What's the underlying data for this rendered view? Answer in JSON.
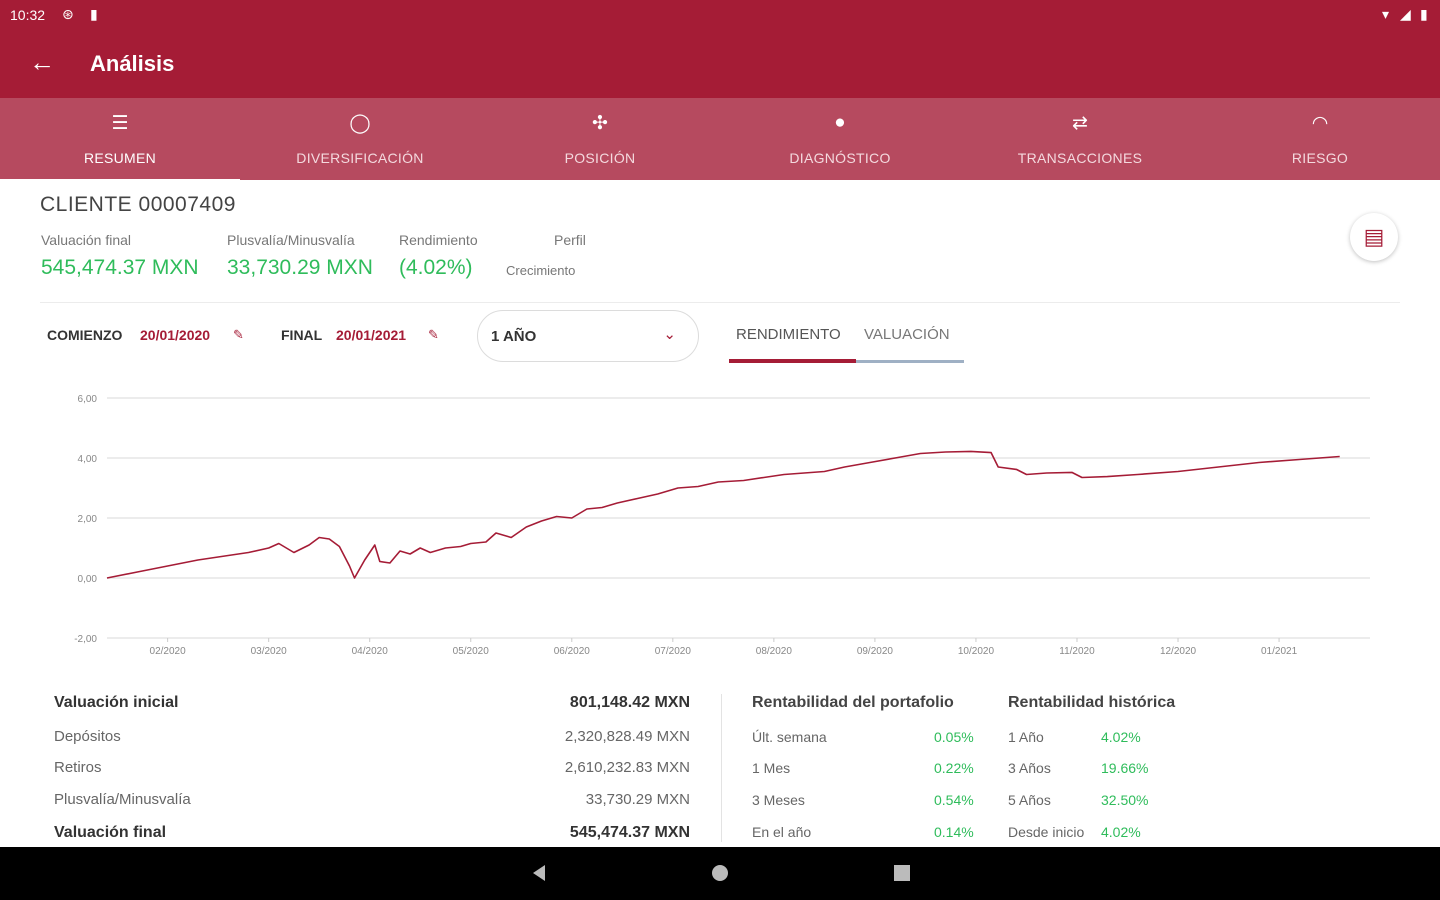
{
  "status_bar": {
    "time": "10:32"
  },
  "app_bar": {
    "title": "Análisis"
  },
  "tabs": [
    {
      "label": "RESUMEN",
      "icon": "list-icon",
      "active": true
    },
    {
      "label": "DIVERSIFICACIÓN",
      "icon": "donut-icon"
    },
    {
      "label": "POSICIÓN",
      "icon": "grid-icon"
    },
    {
      "label": "DIAGNÓSTICO",
      "icon": "magnifier-icon"
    },
    {
      "label": "TRANSACCIONES",
      "icon": "swap-icon"
    },
    {
      "label": "RIESGO",
      "icon": "gauge-icon"
    }
  ],
  "client": {
    "name": "CLIENTE 00007409",
    "valuacion_label": "Valuación final",
    "valuacion_value": "545,474.37 MXN",
    "plusvalia_label": "Plusvalía/Minusvalía",
    "plusvalia_value": "33,730.29 MXN",
    "rendimiento_label": "Rendimiento",
    "rendimiento_value": "(4.02%)",
    "perfil_label": "Perfil",
    "perfil_value": "Crecimiento"
  },
  "filters": {
    "start_label": "COMIENZO",
    "start_date": "20/01/2020",
    "end_label": "FINAL",
    "end_date": "20/01/2021",
    "period_value": "1 AÑO",
    "segment_rendimiento": "RENDIMIENTO",
    "segment_valuacion": "VALUACIÓN"
  },
  "chart_data": {
    "type": "line",
    "ylim": [
      -2,
      6
    ],
    "y_ticks": [
      "6,00",
      "4,00",
      "2,00",
      "0,00",
      "-2,00"
    ],
    "x_ticks": [
      "02/2020",
      "03/2020",
      "04/2020",
      "05/2020",
      "06/2020",
      "07/2020",
      "08/2020",
      "09/2020",
      "10/2020",
      "11/2020",
      "12/2020",
      "01/2021"
    ],
    "series": [
      {
        "color": "#a51c36",
        "points": [
          [
            0.0,
            0.0
          ],
          [
            0.3,
            0.2
          ],
          [
            0.6,
            0.4
          ],
          [
            0.9,
            0.6
          ],
          [
            1.2,
            0.75
          ],
          [
            1.4,
            0.85
          ],
          [
            1.6,
            1.0
          ],
          [
            1.7,
            1.15
          ],
          [
            1.85,
            0.85
          ],
          [
            2.0,
            1.1
          ],
          [
            2.1,
            1.35
          ],
          [
            2.2,
            1.3
          ],
          [
            2.3,
            1.05
          ],
          [
            2.4,
            0.4
          ],
          [
            2.45,
            0.0
          ],
          [
            2.55,
            0.6
          ],
          [
            2.65,
            1.1
          ],
          [
            2.7,
            0.55
          ],
          [
            2.8,
            0.5
          ],
          [
            2.9,
            0.9
          ],
          [
            3.0,
            0.8
          ],
          [
            3.1,
            1.0
          ],
          [
            3.2,
            0.85
          ],
          [
            3.35,
            1.0
          ],
          [
            3.5,
            1.05
          ],
          [
            3.6,
            1.15
          ],
          [
            3.75,
            1.2
          ],
          [
            3.85,
            1.5
          ],
          [
            4.0,
            1.35
          ],
          [
            4.15,
            1.7
          ],
          [
            4.3,
            1.9
          ],
          [
            4.45,
            2.05
          ],
          [
            4.6,
            2.0
          ],
          [
            4.75,
            2.3
          ],
          [
            4.9,
            2.35
          ],
          [
            5.05,
            2.5
          ],
          [
            5.25,
            2.65
          ],
          [
            5.45,
            2.8
          ],
          [
            5.65,
            3.0
          ],
          [
            5.85,
            3.05
          ],
          [
            6.05,
            3.2
          ],
          [
            6.3,
            3.25
          ],
          [
            6.5,
            3.35
          ],
          [
            6.7,
            3.45
          ],
          [
            6.9,
            3.5
          ],
          [
            7.1,
            3.55
          ],
          [
            7.3,
            3.7
          ],
          [
            7.55,
            3.85
          ],
          [
            7.8,
            4.0
          ],
          [
            8.05,
            4.15
          ],
          [
            8.3,
            4.2
          ],
          [
            8.55,
            4.22
          ],
          [
            8.75,
            4.18
          ],
          [
            8.82,
            3.7
          ],
          [
            9.0,
            3.62
          ],
          [
            9.1,
            3.45
          ],
          [
            9.3,
            3.5
          ],
          [
            9.55,
            3.52
          ],
          [
            9.65,
            3.35
          ],
          [
            9.9,
            3.38
          ],
          [
            10.2,
            3.45
          ],
          [
            10.6,
            3.55
          ],
          [
            11.0,
            3.7
          ],
          [
            11.4,
            3.85
          ],
          [
            11.8,
            3.95
          ],
          [
            12.2,
            4.05
          ]
        ]
      }
    ]
  },
  "summary": {
    "rows": [
      {
        "label": "Valuación inicial",
        "value": "801,148.42 MXN",
        "bold": true
      },
      {
        "label": "Depósitos",
        "value": "2,320,828.49 MXN"
      },
      {
        "label": "Retiros",
        "value": "2,610,232.83 MXN"
      },
      {
        "label": "Plusvalía/Minusvalía",
        "value": "33,730.29 MXN"
      },
      {
        "label": "Valuación final",
        "value": "545,474.37 MXN",
        "bold": true
      }
    ]
  },
  "rentabilidad_portafolio": {
    "title": "Rentabilidad del portafolio",
    "rows": [
      {
        "label": "Últ. semana",
        "value": "0.05%"
      },
      {
        "label": "1 Mes",
        "value": "0.22%"
      },
      {
        "label": "3 Meses",
        "value": "0.54%"
      },
      {
        "label": "En el año",
        "value": "0.14%"
      }
    ]
  },
  "rentabilidad_historica": {
    "title": "Rentabilidad histórica",
    "rows": [
      {
        "label": "1 Año",
        "value": "4.02%"
      },
      {
        "label": "3 Años",
        "value": "19.66%"
      },
      {
        "label": "5 Años",
        "value": "32.50%"
      },
      {
        "label": "Desde inicio",
        "value": "4.02%"
      }
    ]
  }
}
